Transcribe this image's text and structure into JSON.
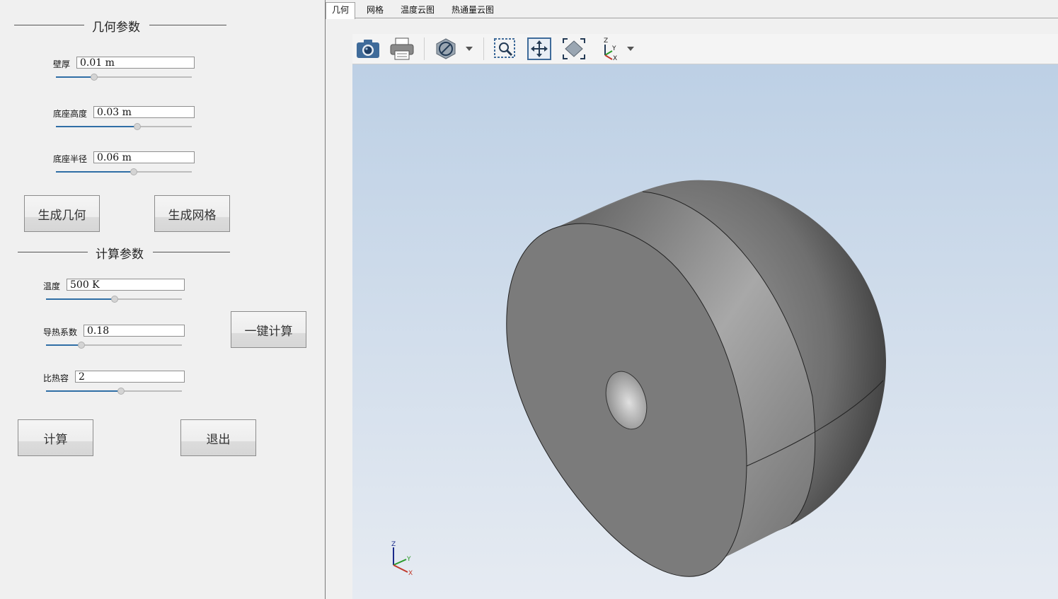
{
  "geometry_section": {
    "title": "几何参数"
  },
  "params": [
    {
      "label": "壁厚",
      "value": "0.01 m",
      "slider": 0.28
    },
    {
      "label": "底座高度",
      "value": "0.03 m",
      "slider": 0.6
    },
    {
      "label": "底座半径",
      "value": "0.06 m",
      "slider": 0.57
    }
  ],
  "buttons": {
    "gen_geometry": "生成几何",
    "gen_mesh": "生成网格",
    "one_click": "一键计算",
    "calc": "计算",
    "exit": "退出"
  },
  "calc_section": {
    "title": "计算参数"
  },
  "calc_params": [
    {
      "label": "温度",
      "value": "500 K",
      "slider": 0.5
    },
    {
      "label": "导热系数",
      "value": "0.18",
      "slider": 0.26
    },
    {
      "label": "比热容",
      "value": "2",
      "slider": 0.55
    }
  ],
  "tabs": [
    {
      "label": "几何",
      "active": true
    },
    {
      "label": "网格",
      "active": false
    },
    {
      "label": "温度云图",
      "active": false
    },
    {
      "label": "热通量云图",
      "active": false
    }
  ],
  "toolbar_icons": [
    "camera-icon",
    "print-icon",
    "display-mode-icon",
    "dropdown-arrow-icon",
    "zoom-window-icon",
    "pan-icon",
    "fit-all-icon",
    "axis-view-icon",
    "dropdown-arrow-icon"
  ],
  "axis_triad": {
    "z": "Z",
    "y": "Y",
    "x": "X"
  },
  "colors": {
    "accent": "#2f6ea5",
    "viewport_top": "#bdd0e5",
    "viewport_bottom": "#e6ebf2",
    "model_face": "#7d7d7d"
  }
}
